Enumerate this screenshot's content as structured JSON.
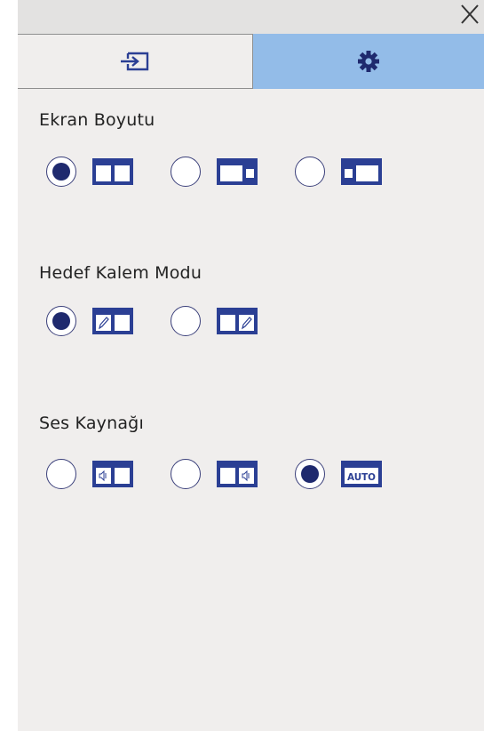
{
  "window": {
    "close_icon": "close-x-icon"
  },
  "tabs": [
    {
      "icon": "input-source-icon",
      "selected": false
    },
    {
      "icon": "gear-icon",
      "selected": true
    }
  ],
  "sections": {
    "screen_size": {
      "title": "Ekran Boyutu",
      "options": [
        {
          "icon": "split-equal-icon",
          "selected": true
        },
        {
          "icon": "split-left-large-icon",
          "selected": false
        },
        {
          "icon": "split-right-large-icon",
          "selected": false
        }
      ]
    },
    "pen_mode": {
      "title": "Hedef Kalem Modu",
      "options": [
        {
          "icon": "pen-left-icon",
          "selected": true
        },
        {
          "icon": "pen-right-icon",
          "selected": false
        }
      ]
    },
    "audio_source": {
      "title": "Ses Kaynağı",
      "options": [
        {
          "icon": "audio-left-icon",
          "selected": false
        },
        {
          "icon": "audio-right-icon",
          "selected": false
        },
        {
          "icon": "audio-auto-icon",
          "label": "AUTO",
          "selected": true
        }
      ]
    }
  },
  "colors": {
    "background": "#f0eeed",
    "selected_tab": "#93bce8",
    "icon_blue": "#2b3f94",
    "radio_fill": "#1f2a6e"
  }
}
